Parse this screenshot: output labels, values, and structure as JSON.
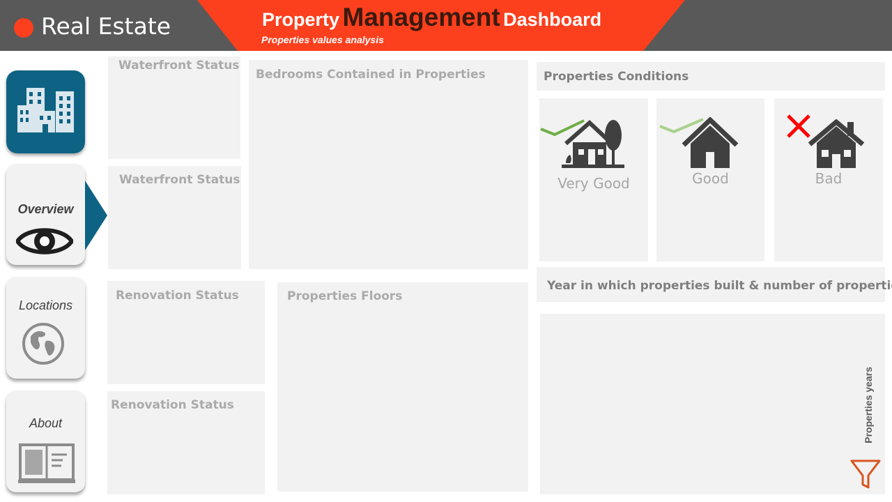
{
  "header": {
    "brand": "Real Estate",
    "title_part1": "Property",
    "title_part2": "Management",
    "title_part3": "Dashboard",
    "subtitle": "Properties values analysis"
  },
  "nav": {
    "logo_icon": "buildings-icon",
    "items": [
      {
        "label": "Overview",
        "icon": "eye-icon",
        "active": true
      },
      {
        "label": "Locations",
        "icon": "globe-icon",
        "active": false
      },
      {
        "label": "About",
        "icon": "book-icon",
        "active": false
      }
    ]
  },
  "panels": {
    "waterfront_1": "Waterfront Status",
    "waterfront_2": "Waterfront Status",
    "bedrooms": "Bedrooms Contained  in Properties",
    "renovation_1": "Renovation Status",
    "renovation_2": "Renovation Status",
    "floors": "Properties Floors",
    "conditions": "Properties  Conditions",
    "year_built": "Year in which properties built  & number of properties",
    "years_filter_label": "Properties years"
  },
  "conditions": [
    {
      "label": "Very Good",
      "mark": "check-icon",
      "mark_color": "#70ad47"
    },
    {
      "label": "Good",
      "mark": "check-icon",
      "mark_color": "#a9d18e"
    },
    {
      "label": "Bad",
      "mark": "cross-icon",
      "mark_color": "#ff0000"
    }
  ],
  "colors": {
    "accent": "#fc3f1d",
    "header_bg": "#595959",
    "nav_blue": "#0e6384",
    "panel_bg": "#f2f2f2"
  }
}
